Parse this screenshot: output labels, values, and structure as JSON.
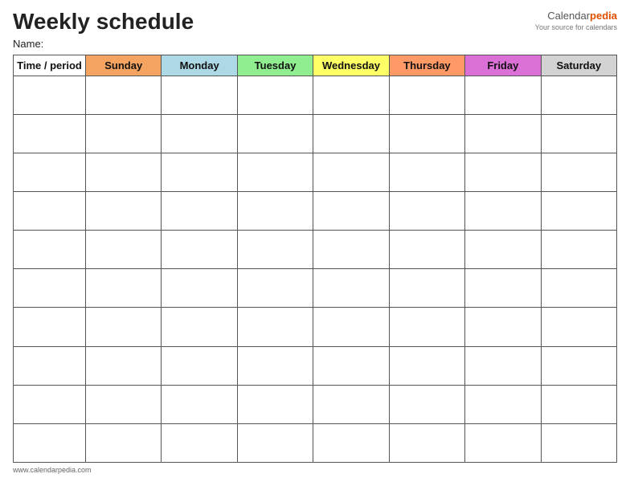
{
  "title": "Weekly schedule",
  "brand": {
    "name_part1": "Calendar",
    "name_part2": "pedia",
    "tagline": "Your source for calendars"
  },
  "name_label": "Name:",
  "columns": {
    "time_period": "Time / period",
    "sunday": "Sunday",
    "monday": "Monday",
    "tuesday": "Tuesday",
    "wednesday": "Wednesday",
    "thursday": "Thursday",
    "friday": "Friday",
    "saturday": "Saturday"
  },
  "row_count": 10,
  "footer": "www.calendarpedia.com"
}
